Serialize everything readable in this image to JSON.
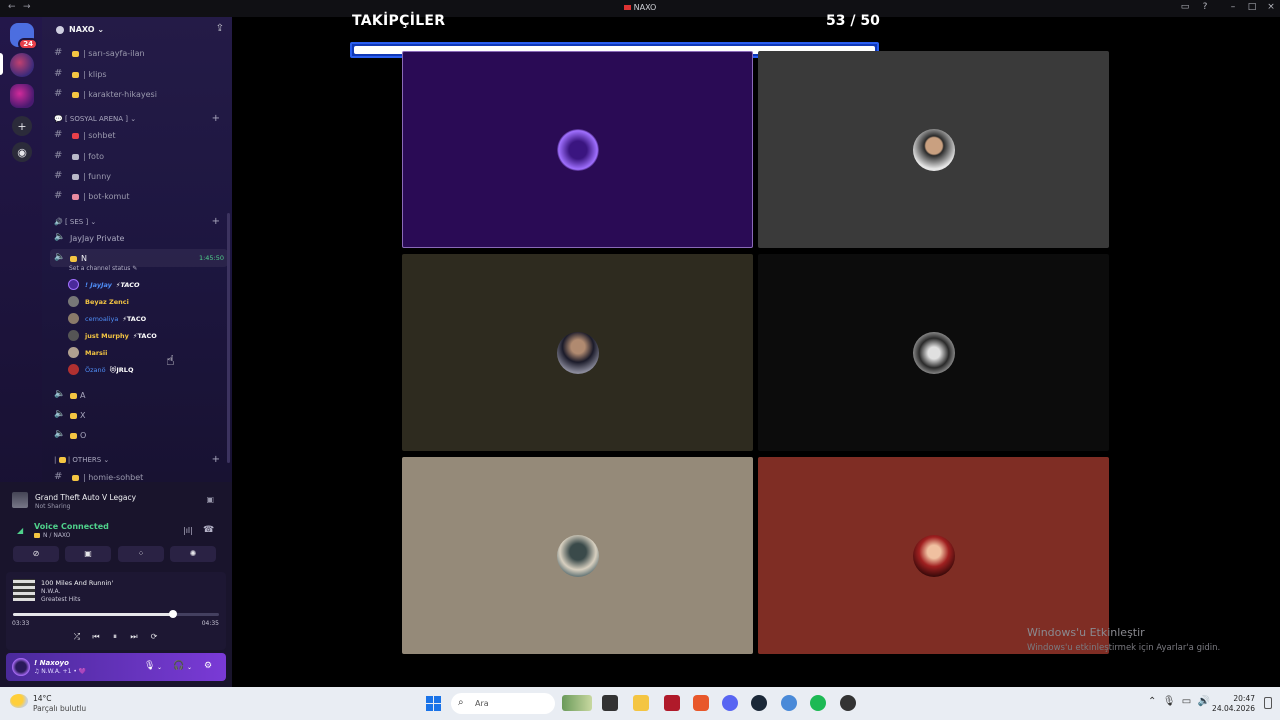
{
  "window": {
    "title": "NAXO"
  },
  "rail": {
    "dm_badge": "24"
  },
  "server": {
    "name": "NAXO"
  },
  "channels_top": [
    {
      "label": "| sarı-sayfa-ilan"
    },
    {
      "label": "| klips"
    },
    {
      "label": "| karakter-hikayesi"
    }
  ],
  "cat_social": "[ SOSYAL ARENA ]",
  "channels_social": [
    {
      "label": "| sohbet"
    },
    {
      "label": "| foto"
    },
    {
      "label": "| funny"
    },
    {
      "label": "| bot-komut"
    }
  ],
  "cat_voice": "[ SES ]",
  "voice_private": "JayJay Private",
  "voice_active": {
    "name": "N",
    "timer": "1:45:50",
    "status": "Set a channel status"
  },
  "members": [
    {
      "name": "! JayJay",
      "tag": "⚡TACO",
      "color": "#4f8ef7"
    },
    {
      "name": "Beyaz Zenci",
      "tag": "",
      "color": "#f4c542"
    },
    {
      "name": "cemoaliya",
      "tag": "⚡TACO",
      "color": "#4f8ef7"
    },
    {
      "name": "just Murphy",
      "tag": "⚡TACO",
      "color": "#f4c542"
    },
    {
      "name": "Marsii",
      "tag": "",
      "color": "#f4c542"
    },
    {
      "name": "Özanö",
      "tag": "😻JRLQ",
      "color": "#4f8ef7"
    }
  ],
  "voice_other": [
    {
      "name": "A"
    },
    {
      "name": "X"
    },
    {
      "name": "O"
    }
  ],
  "cat_others": "| OTHERS",
  "channel_homie": "| homie-sohbet",
  "activity": {
    "game": "Grand Theft Auto V Legacy",
    "sub": "Not Sharing"
  },
  "voice_conn": {
    "title": "Voice Connected",
    "sub": "N / NAXO"
  },
  "music": {
    "song": "100 Miles And Runnin'",
    "artist": "N.W.A.",
    "album": "Greatest Hits",
    "elapsed": "03:33",
    "total": "04:35",
    "progress": 0.775
  },
  "user": {
    "name": "! Naxoyo",
    "status": "♫ N.W.A. +1 • 💜"
  },
  "overlay": {
    "title": "TAKİPÇİLER",
    "count": "53 / 50",
    "progress": 1.0
  },
  "tiles": [
    {
      "bg": "#2a0b55",
      "avatar": "radial-gradient(circle, #3a1580 30%, #a070ff 65%, #2a0b55 72%)",
      "border": "#8a6ab8"
    },
    {
      "bg": "#3a3a3a",
      "avatar": "radial-gradient(circle at 50% 40%, #c9a080 25%, #2a2a2a 30%, #e6e6e6 70%)",
      "border": ""
    },
    {
      "bg": "#2e2b1f",
      "avatar": "radial-gradient(circle at 50% 35%, #b08a70 20%, #1b1b2a 45%, #8a8a9a 75%)",
      "border": ""
    },
    {
      "bg": "#0c0c0c",
      "avatar": "radial-gradient(circle, #e0e0e0 20%, #2a2a2a 50%, #9a9a9a 75%)",
      "border": ""
    },
    {
      "bg": "#958a79",
      "avatar": "radial-gradient(circle at 50% 40%, #3a4a4a 25%, #d8d0c0 55%, #6a7a7a 75%)",
      "border": ""
    },
    {
      "bg": "#7f2d24",
      "avatar": "radial-gradient(circle at 50% 40%, #f0c0a0 20%, #a02020 45%, #3a0a0a 75%)",
      "border": ""
    }
  ],
  "watermark": {
    "title": "Windows'u Etkinleştir",
    "body": "Windows'u etkinleştirmek için Ayarlar'a gidin."
  },
  "taskbar": {
    "temp": "14°C",
    "weather": "Parçalı bulutlu",
    "search_placeholder": "Ara",
    "time": "20:47",
    "date": "24.04.2026"
  }
}
